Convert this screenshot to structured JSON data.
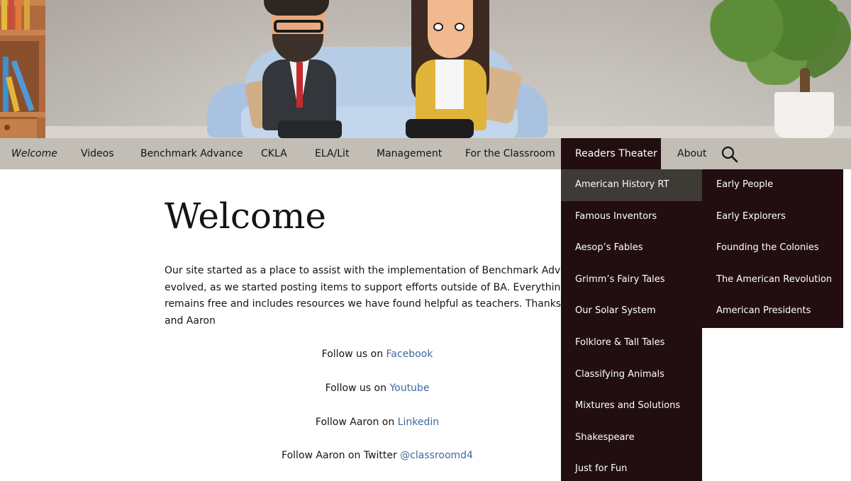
{
  "nav": {
    "items": [
      {
        "label": "Welcome"
      },
      {
        "label": "Videos"
      },
      {
        "label": "Benchmark Advance"
      },
      {
        "label": "CKLA"
      },
      {
        "label": "ELA/Lit"
      },
      {
        "label": "Management"
      },
      {
        "label": "For the Classroom"
      },
      {
        "label": "Readers Theater"
      },
      {
        "label": "About"
      }
    ],
    "search_icon": "search-icon"
  },
  "dropdown": {
    "items": [
      {
        "label": "American History RT"
      },
      {
        "label": "Famous Inventors"
      },
      {
        "label": "Aesop’s Fables"
      },
      {
        "label": "Grimm’s Fairy Tales"
      },
      {
        "label": "Our Solar System"
      },
      {
        "label": "Folklore & Tall Tales"
      },
      {
        "label": "Classifying Animals"
      },
      {
        "label": "Mixtures and Solutions"
      },
      {
        "label": "Shakespeare"
      },
      {
        "label": "Just for Fun"
      }
    ]
  },
  "subdropdown": {
    "items": [
      {
        "label": "Early People"
      },
      {
        "label": "Early Explorers"
      },
      {
        "label": "Founding the Colonies"
      },
      {
        "label": "The American Revolution"
      },
      {
        "label": "American Presidents"
      }
    ]
  },
  "main": {
    "title": "Welcome",
    "intro_lines": [
      "Our site started as a place to assist with the implementation of Benchmark Advance.",
      "evolved, as we started posting items to support efforts outside of BA. Everything on t",
      "remains free and includes resources we have found helpful as teachers. Thanks! Mari",
      "and Aaron"
    ],
    "follow": [
      {
        "prefix": "Follow us on ",
        "link": "Facebook"
      },
      {
        "prefix": "Follow us on ",
        "link": "Youtube"
      },
      {
        "prefix": "Follow Aaron on ",
        "link": "Linkedin"
      },
      {
        "prefix": "Follow Aaron on Twitter ",
        "link": "@classroomd4"
      }
    ]
  },
  "colors": {
    "nav_bg": "#c2bdb5",
    "menu_bg": "#220e10",
    "menu_hover": "#3e3a36",
    "link": "#3b6aa0"
  }
}
